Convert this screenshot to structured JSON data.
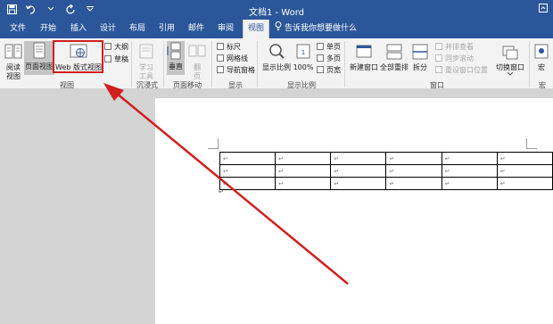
{
  "window": {
    "title": "文档1 - Word"
  },
  "tabs": [
    "文件",
    "开始",
    "插入",
    "设计",
    "布局",
    "引用",
    "邮件",
    "审阅",
    "视图"
  ],
  "active_tab": "视图",
  "tell_me": "告诉我你想要做什么",
  "ribbon": {
    "views": {
      "read_mode": "阅读\n视图",
      "read_mode_1": "阅读",
      "read_mode_2": "视图",
      "print_layout": "页面视图",
      "web_layout": "Web 版式视图",
      "outline": "大纲",
      "draft": "草稿",
      "group": "视图"
    },
    "immersive": {
      "learning_tools_1": "学习",
      "learning_tools_2": "工具",
      "group": "沉浸式"
    },
    "page_movement": {
      "vertical": "垂直",
      "side_to_side_1": "翻",
      "side_to_side_2": "页",
      "group": "页面移动"
    },
    "show": {
      "ruler": "标尺",
      "gridlines": "网格线",
      "nav_pane": "导航窗格",
      "group": "显示"
    },
    "zoom": {
      "zoom": "显示比例",
      "hundred": "100%",
      "one_page": "单页",
      "multi_page": "多页",
      "page_width": "页宽",
      "group": "显示比例"
    },
    "window": {
      "new_window": "新建窗口",
      "arrange_all": "全部重排",
      "split": "拆分",
      "side_by_side": "并排查看",
      "sync_scroll": "同步滚动",
      "reset_pos": "重设窗口位置",
      "switch": "切换窗口",
      "group": "窗口"
    },
    "macros": {
      "macros": "宏",
      "group": "宏"
    }
  },
  "table_rows": [
    [
      "↵",
      "↵",
      "↵",
      "↵",
      "↵",
      "↵"
    ],
    [
      "↵",
      "↵",
      "↵",
      "↵",
      "↵",
      "↵"
    ],
    [
      "↵",
      "↵",
      "↵",
      "↵",
      "↵",
      "↵"
    ]
  ],
  "paragraph_mark": "↵",
  "colors": {
    "accent": "#2b579a",
    "annotation": "#d21f1f"
  }
}
